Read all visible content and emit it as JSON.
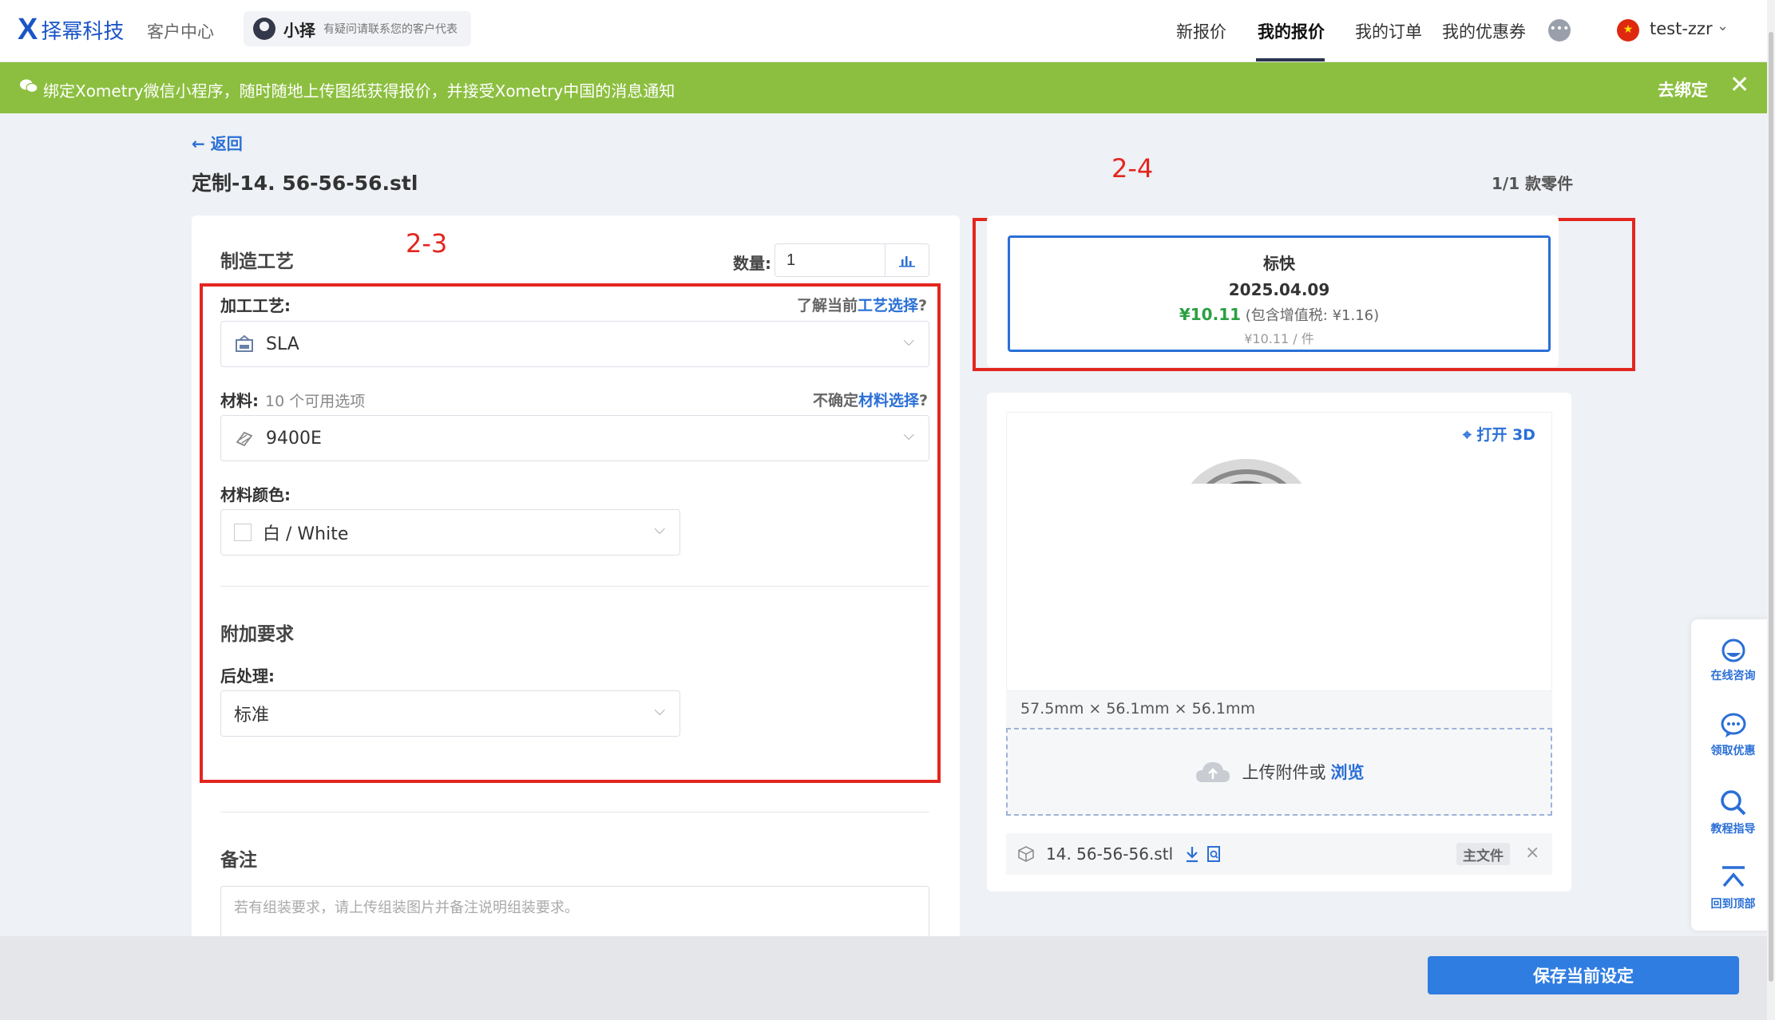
{
  "header": {
    "logo_mark": "X",
    "logo_text": "择幂科技",
    "client_center": "客户中心",
    "agent_name": "小择",
    "agent_hint": "有疑问请联系您的客户代表",
    "nav": [
      "新报价",
      "我的报价",
      "我的订单",
      "我的优惠券"
    ],
    "active_nav": "我的报价",
    "user_name": "test-zzr"
  },
  "banner": {
    "text": "绑定Xometry微信小程序，随时随地上传图纸获得报价，并接受Xometry中国的消息通知",
    "unbind_label": "去绑定",
    "close_glyph": "✕",
    "color": "#8cbf3f"
  },
  "page": {
    "back_label": "← 返回",
    "file_title": "定制-14. 56-56-56.stl",
    "parts_count": "1/1 款零件"
  },
  "annotations": {
    "left_label": "2-3",
    "right_label": "2-4",
    "color": "#e3261f"
  },
  "form": {
    "section_title": "制造工艺",
    "qty_label": "数量:",
    "qty_value": "1",
    "process_label": "加工工艺:",
    "process_help_prefix": "了解当前",
    "process_help_link": "工艺选择",
    "process_help_suffix": "?",
    "process_value": "SLA",
    "material_label": "材料:",
    "material_options_count": "10 个可用选项",
    "material_help_prefix": "不确定",
    "material_help_link": "材料选择",
    "material_help_suffix": "?",
    "material_value": "9400E",
    "color_label": "材料颜色:",
    "color_value": "白 / White",
    "extra_title": "附加要求",
    "post_label": "后处理:",
    "post_value": "标准",
    "notes_title": "备注",
    "notes_placeholder": "若有组装要求，请上传组装图片并备注说明组装要求。"
  },
  "quote": {
    "type": "标快",
    "date": "2025.04.09",
    "price": "¥10.11",
    "tax_note": "(包含增值税: ¥1.16)",
    "unit_price": "¥10.11 / 件"
  },
  "viewer": {
    "open_3d_label": "打开 3D",
    "dimensions": "57.5mm × 56.1mm × 56.1mm",
    "upload_text": "上传附件或",
    "upload_link": "浏览",
    "file_name": "14. 56-56-56.stl",
    "main_tag": "主文件",
    "close_glyph": "×"
  },
  "floatbar": [
    "在线咨询",
    "领取优惠",
    "教程指导",
    "回到顶部"
  ],
  "footer": {
    "save_label": "保存当前设定"
  },
  "colors": {
    "brand": "#1b55c7",
    "accent": "#2a6fd6",
    "price_green": "#2aa042",
    "save_button": "#2f7de1"
  }
}
